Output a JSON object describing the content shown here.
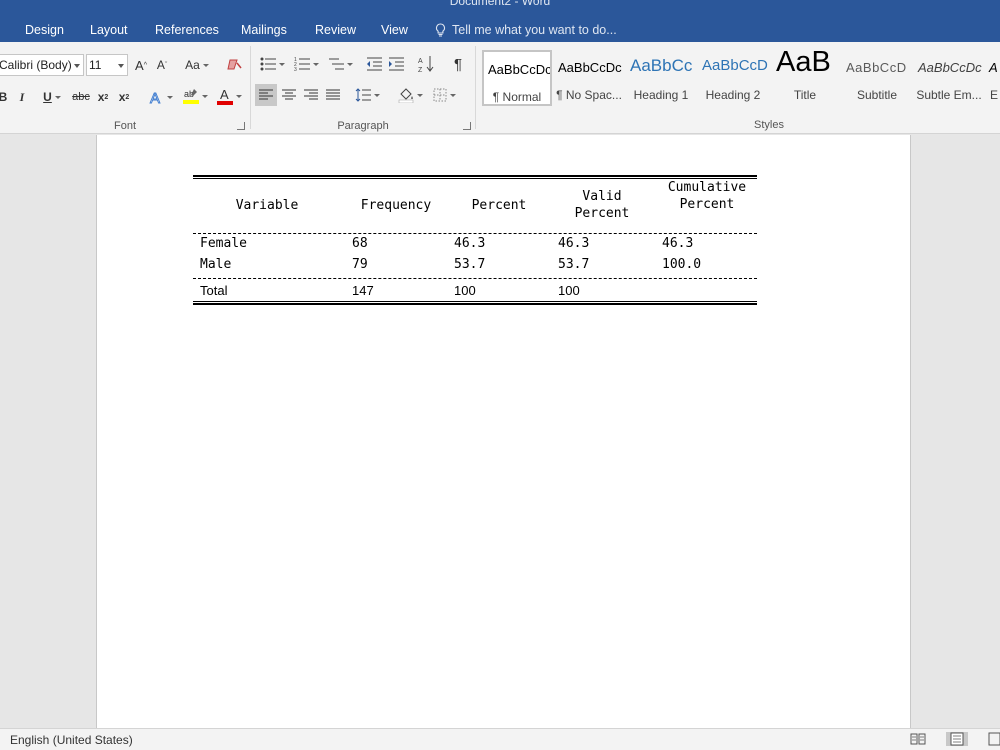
{
  "window": {
    "title": "Document2 - Word"
  },
  "menu": {
    "items": [
      "Design",
      "Layout",
      "References",
      "Mailings",
      "Review",
      "View"
    ],
    "tell_me": "Tell me what you want to do..."
  },
  "ribbon": {
    "font": {
      "name": "Calibri (Body)",
      "size": "11",
      "group_label": "Font",
      "change_case": "Aa",
      "strike_label": "abc"
    },
    "paragraph": {
      "group_label": "Paragraph"
    },
    "styles": {
      "group_label": "Styles",
      "items": [
        {
          "preview": "AaBbCcDc",
          "name": "¶ Normal",
          "selected": true
        },
        {
          "preview": "AaBbCcDc",
          "name": "¶ No Spac..."
        },
        {
          "preview": "AaBbCc",
          "name": "Heading 1"
        },
        {
          "preview": "AaBbCcD",
          "name": "Heading 2"
        },
        {
          "preview": "AaB",
          "name": "Title"
        },
        {
          "preview": "AaBbCcD",
          "name": "Subtitle"
        },
        {
          "preview": "AaBbCcDc",
          "name": "Subtle Em..."
        },
        {
          "preview": "A",
          "name": "E"
        }
      ]
    },
    "colors": {
      "highlight": "#ffff00",
      "font_color": "#e00000",
      "text_effects": "#3c7bd0"
    }
  },
  "document": {
    "table": {
      "headers": [
        "Variable",
        "Frequency",
        "Percent",
        "Valid\nPercent",
        "Cumulative\nPercent"
      ],
      "rows": [
        [
          "Female",
          "68",
          "46.3",
          "46.3",
          "46.3"
        ],
        [
          "Male",
          "79",
          "53.7",
          "53.7",
          "100.0"
        ]
      ],
      "total": [
        "Total",
        "147",
        "100",
        "100",
        ""
      ]
    }
  },
  "status": {
    "language": "English (United States)"
  },
  "theme": {
    "accent": "#2b579a"
  }
}
